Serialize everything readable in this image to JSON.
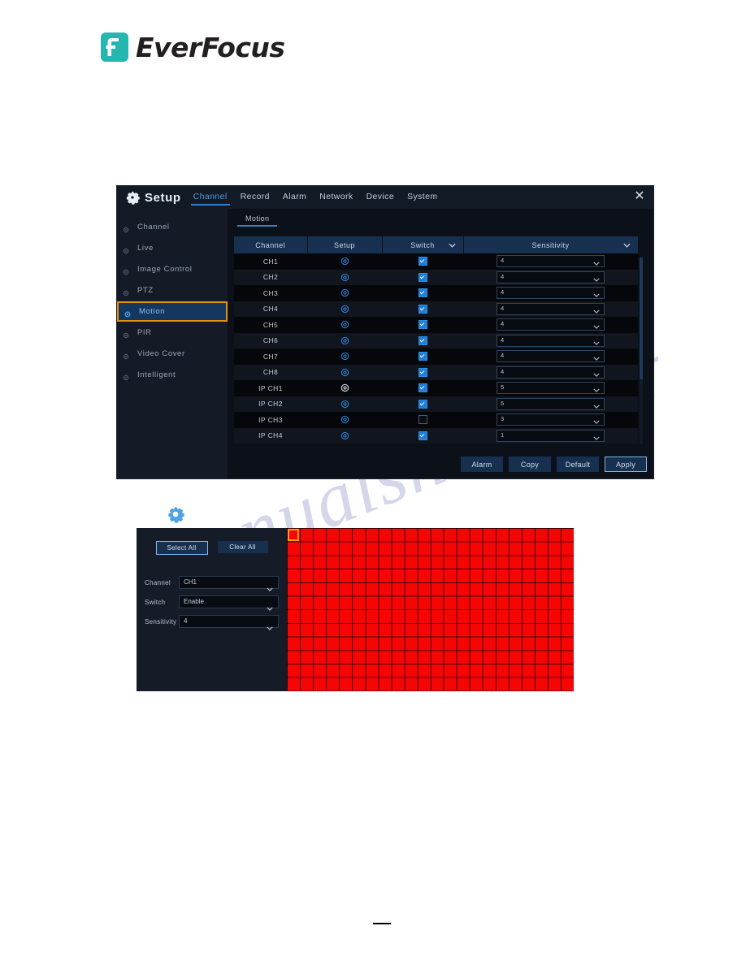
{
  "logo": {
    "text": "EverFocus",
    "mark_color": "#25b6b0"
  },
  "watermark": {
    "text": "manualshive.com"
  },
  "setup_window": {
    "title": "Setup",
    "title_icon": "gear-icon",
    "close_icon": "close-icon",
    "top_tabs": [
      {
        "label": "Channel",
        "active": true
      },
      {
        "label": "Record",
        "active": false
      },
      {
        "label": "Alarm",
        "active": false
      },
      {
        "label": "Network",
        "active": false
      },
      {
        "label": "Device",
        "active": false
      },
      {
        "label": "System",
        "active": false
      }
    ],
    "sidebar": {
      "items": [
        {
          "label": "Channel",
          "active": false
        },
        {
          "label": "Live",
          "active": false
        },
        {
          "label": "Image Control",
          "active": false
        },
        {
          "label": "PTZ",
          "active": false
        },
        {
          "label": "Motion",
          "active": true
        },
        {
          "label": "PIR",
          "active": false
        },
        {
          "label": "Video Cover",
          "active": false
        },
        {
          "label": "Intelligent",
          "active": false
        }
      ],
      "highlight_color": "#e3920e"
    },
    "subtabs": [
      {
        "label": "Motion",
        "active": true
      }
    ],
    "table": {
      "columns": [
        "Channel",
        "Setup",
        "Switch",
        "Sensitivity"
      ],
      "switch_has_chevron": true,
      "sensitivity_has_chevron": true,
      "rows": [
        {
          "channel": "CH1",
          "setup_icon": "gear-icon",
          "switch": true,
          "sensitivity": "4"
        },
        {
          "channel": "CH2",
          "setup_icon": "gear-icon",
          "switch": true,
          "sensitivity": "4"
        },
        {
          "channel": "CH3",
          "setup_icon": "gear-icon",
          "switch": true,
          "sensitivity": "4"
        },
        {
          "channel": "CH4",
          "setup_icon": "gear-icon",
          "switch": true,
          "sensitivity": "4"
        },
        {
          "channel": "CH5",
          "setup_icon": "gear-icon",
          "switch": true,
          "sensitivity": "4"
        },
        {
          "channel": "CH6",
          "setup_icon": "gear-icon",
          "switch": true,
          "sensitivity": "4"
        },
        {
          "channel": "CH7",
          "setup_icon": "gear-icon",
          "switch": true,
          "sensitivity": "4"
        },
        {
          "channel": "CH8",
          "setup_icon": "gear-icon",
          "switch": true,
          "sensitivity": "4"
        },
        {
          "channel": "IP CH1",
          "setup_icon": "gear-icon",
          "switch": true,
          "sensitivity": "5"
        },
        {
          "channel": "IP CH2",
          "setup_icon": "gear-icon",
          "switch": true,
          "sensitivity": "5"
        },
        {
          "channel": "IP CH3",
          "setup_icon": "gear-icon",
          "switch": false,
          "sensitivity": "3"
        },
        {
          "channel": "IP CH4",
          "setup_icon": "gear-icon",
          "switch": true,
          "sensitivity": "1"
        }
      ]
    },
    "buttons": [
      {
        "label": "Alarm",
        "primary": false
      },
      {
        "label": "Copy",
        "primary": false
      },
      {
        "label": "Default",
        "primary": false
      },
      {
        "label": "Apply",
        "primary": true
      }
    ]
  },
  "mid_gear_icon": "gear-icon",
  "motion_panel": {
    "select_all_label": "Select All",
    "clear_all_label": "Clear All",
    "fields": [
      {
        "label": "Channel",
        "value": "CH1"
      },
      {
        "label": "Switch",
        "value": "Enable"
      },
      {
        "label": "Sensitivity",
        "value": "4"
      }
    ],
    "grid": {
      "columns": 22,
      "rows": 12,
      "fill_color": "#f60505",
      "cursor_color": "#f0a307",
      "cursor_cell": {
        "col": 0,
        "row": 0
      }
    }
  }
}
